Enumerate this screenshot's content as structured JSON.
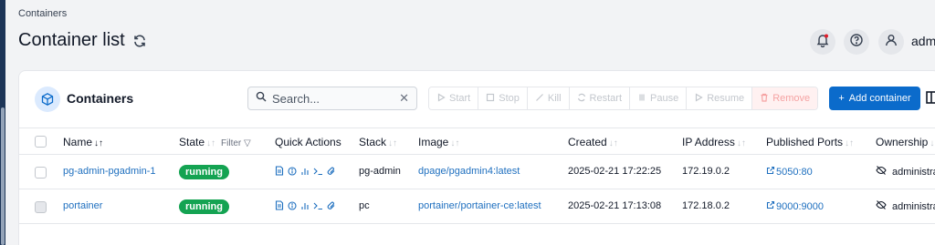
{
  "breadcrumb": "Containers",
  "page_title": "Container list",
  "header": {
    "user_label": "admin"
  },
  "card": {
    "title": "Containers",
    "search": {
      "placeholder": "Search...",
      "value": ""
    },
    "actions": {
      "start": "Start",
      "stop": "Stop",
      "kill": "Kill",
      "restart": "Restart",
      "pause": "Pause",
      "resume": "Resume",
      "remove": "Remove"
    },
    "add_label": "Add container"
  },
  "columns": {
    "name": "Name",
    "state": "State",
    "state_filter": "Filter",
    "quick_actions": "Quick Actions",
    "stack": "Stack",
    "image": "Image",
    "created": "Created",
    "ip": "IP Address",
    "ports": "Published Ports",
    "ownership": "Ownership"
  },
  "rows": [
    {
      "name": "pg-admin-pgadmin-1",
      "state": "running",
      "stack": "pg-admin",
      "image": "dpage/pgadmin4:latest",
      "created": "2025-02-21 17:22:25",
      "ip": "172.19.0.2",
      "ports": "5050:80",
      "ownership": "administrators"
    },
    {
      "name": "portainer",
      "state": "running",
      "stack": "pc",
      "image": "portainer/portainer-ce:latest",
      "created": "2025-02-21 17:13:08",
      "ip": "172.18.0.2",
      "ports": "9000:9000",
      "ownership": "administrators"
    }
  ],
  "colors": {
    "primary": "#0b6bcb",
    "running": "#14a352",
    "link": "#1e6fbf",
    "remove": "#f5a3a3"
  },
  "icons": [
    "refresh-icon",
    "bell-icon",
    "help-icon",
    "user-icon",
    "cube-icon",
    "search-icon",
    "clear-icon",
    "play-icon",
    "stop-icon",
    "kill-icon",
    "restart-icon",
    "pause-icon",
    "resume-icon",
    "trash-icon",
    "plus-icon",
    "columns-icon",
    "filter-icon",
    "logs-icon",
    "inspect-icon",
    "stats-icon",
    "console-icon",
    "attach-icon",
    "external-link-icon",
    "eye-off-icon"
  ]
}
